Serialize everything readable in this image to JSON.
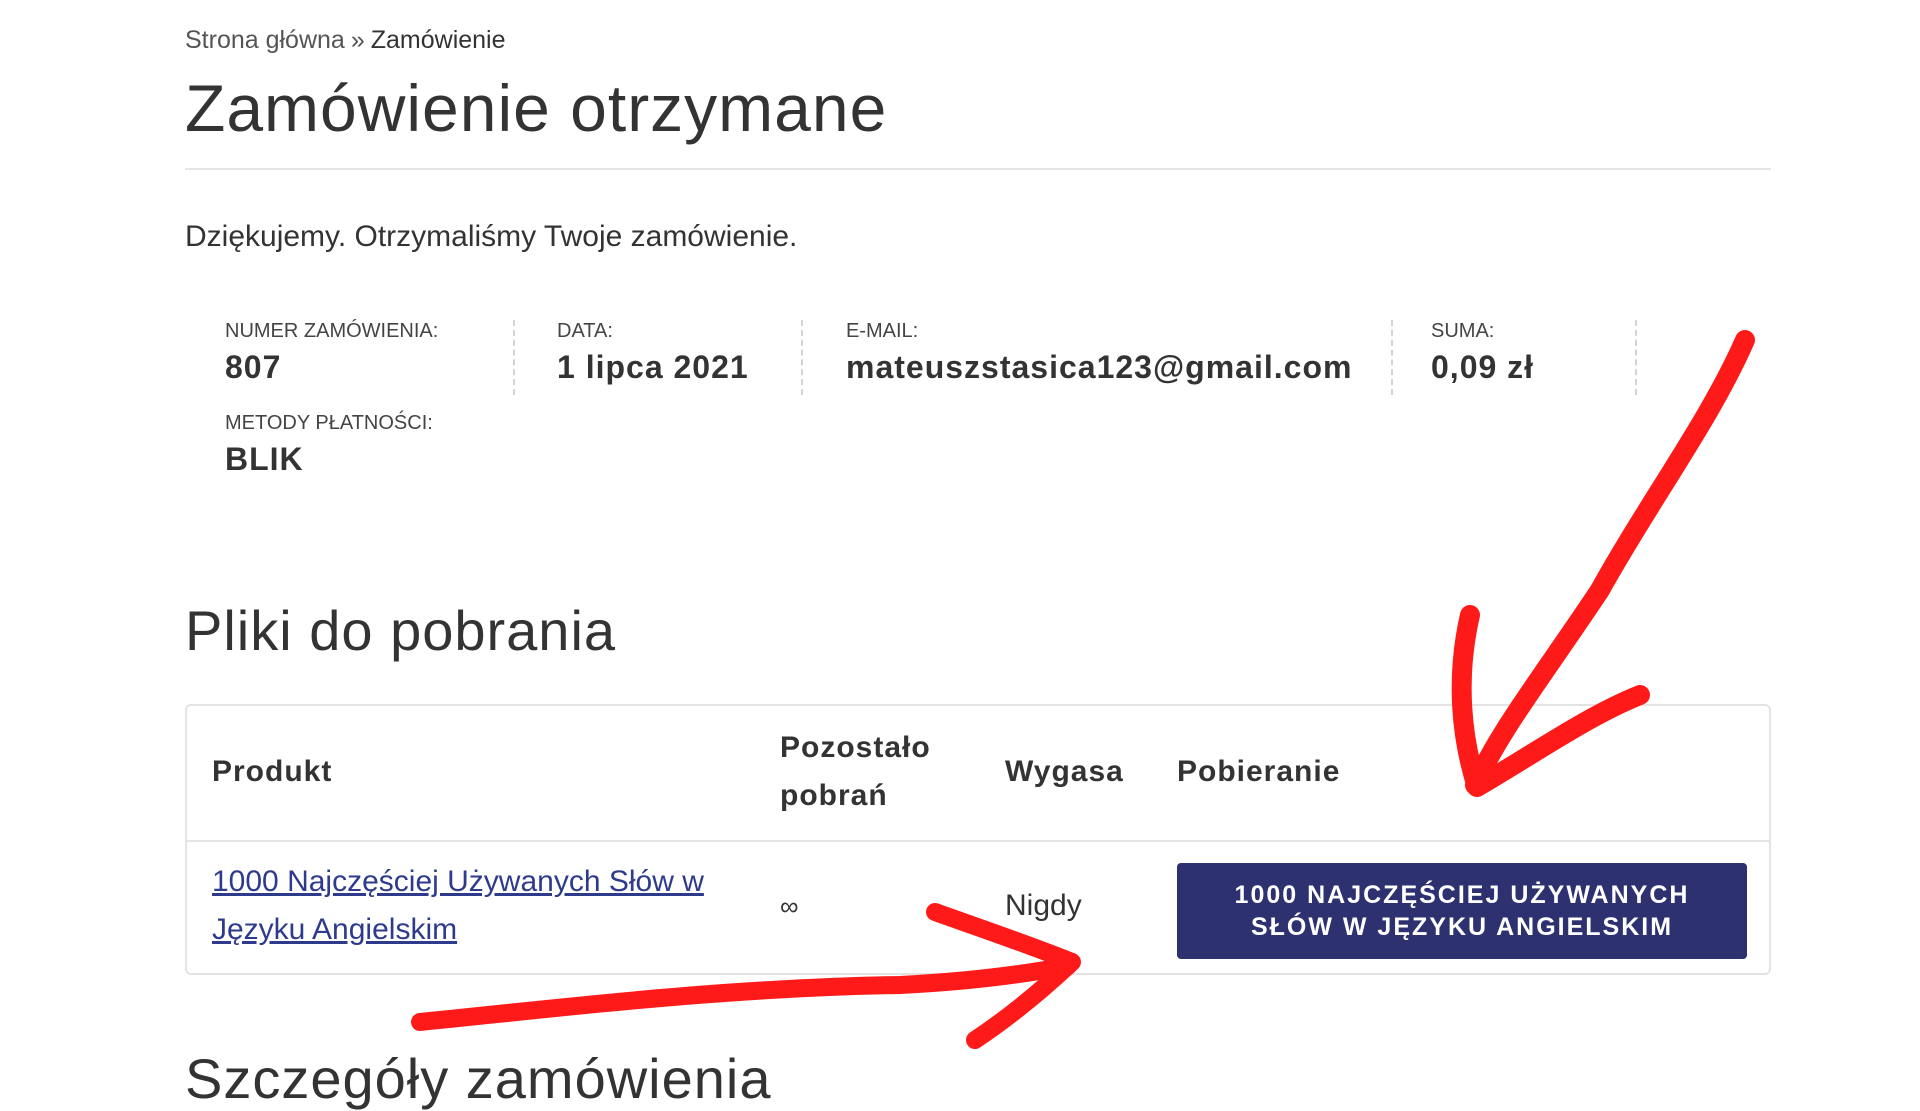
{
  "breadcrumb": {
    "home": "Strona główna",
    "separator": "»",
    "current": "Zamówienie"
  },
  "page_title": "Zamówienie otrzymane",
  "thank_you": "Dziękujemy. Otrzymaliśmy Twoje zamówienie.",
  "order_overview": {
    "order_number_label": "NUMER ZAMÓWIENIA:",
    "order_number": "807",
    "date_label": "DATA:",
    "date": "1 lipca 2021",
    "email_label": "E-MAIL:",
    "email": "mateuszstasica123@gmail.com",
    "total_label": "SUMA:",
    "total": "0,09 zł",
    "payment_method_label": "METODY PŁATNOŚCI:",
    "payment_method": "BLIK"
  },
  "downloads": {
    "title": "Pliki do pobrania",
    "headers": {
      "product": "Produkt",
      "remaining": "Pozostało pobrań",
      "expires": "Wygasa",
      "download": "Pobieranie"
    },
    "rows": [
      {
        "product": "1000 Najczęściej Używanych Słów w Języku Angielskim",
        "remaining": "∞",
        "expires": "Nigdy",
        "button": "1000 NAJCZĘŚCIEJ UŻYWANYCH SŁÓW W JĘZYKU ANGIELSKIM"
      }
    ]
  },
  "next_section_title": "Szczegóły zamówienia",
  "colors": {
    "button_bg": "#2e3170",
    "link": "#2e3a8c",
    "annotation_arrow": "#ff1a1a"
  },
  "icons": {
    "annotation": "hand-drawn-red-arrows"
  }
}
